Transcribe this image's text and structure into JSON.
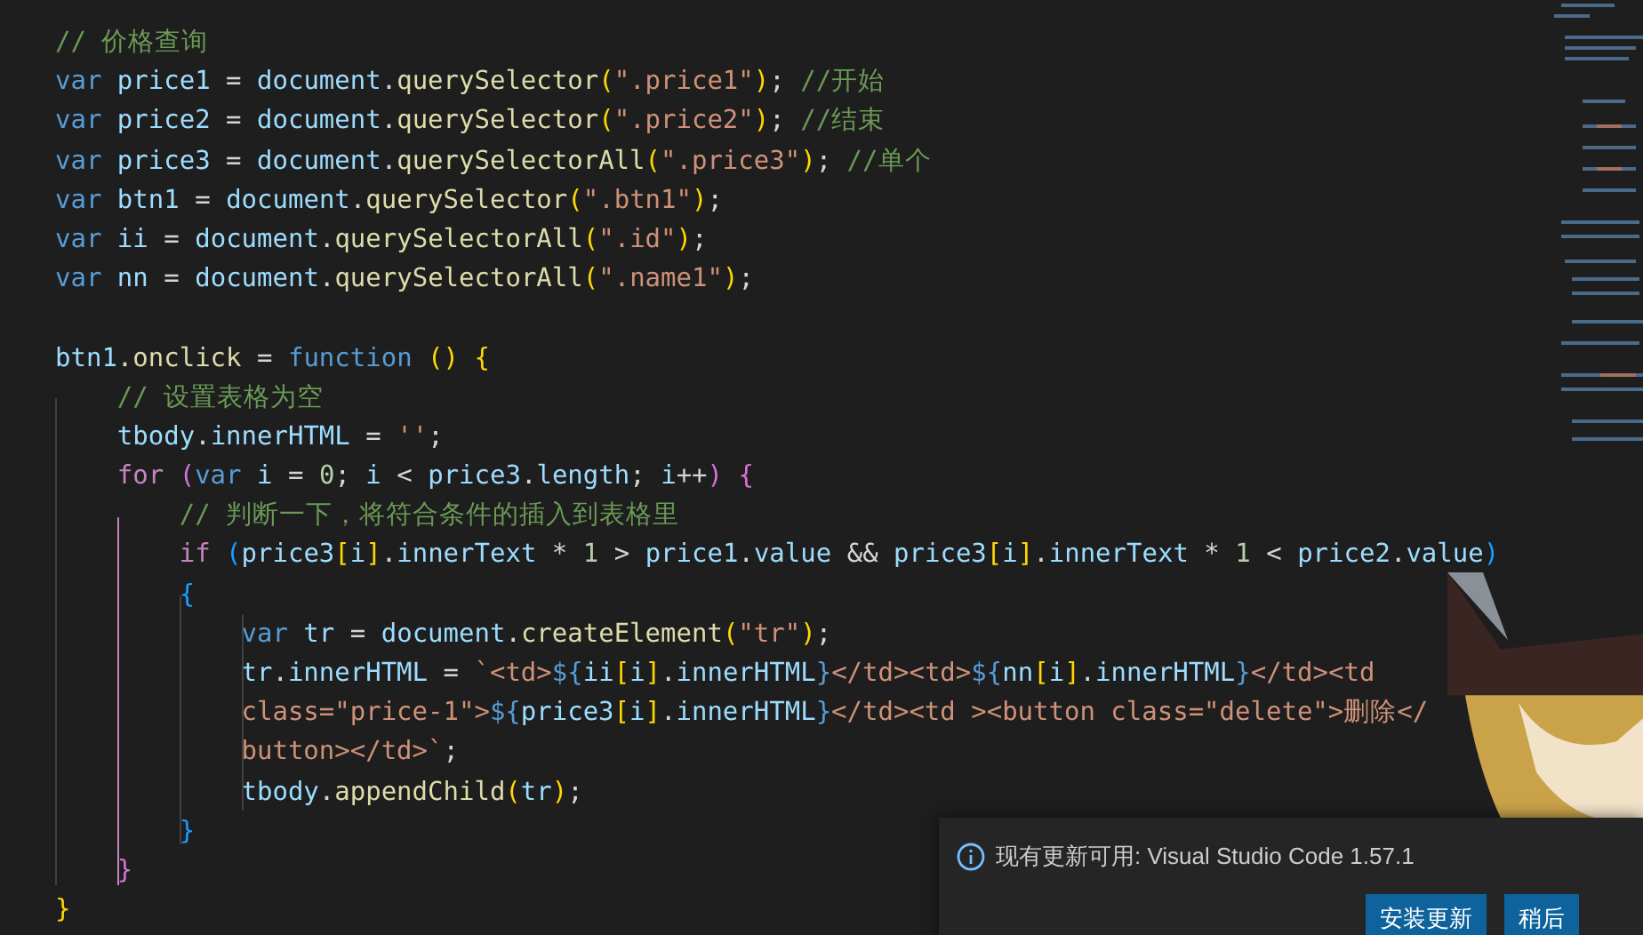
{
  "editor": {
    "code_lines": [
      {
        "kind": "code",
        "tokens": [
          {
            "kind": "cmt",
            "text": "// 价格查询"
          }
        ]
      },
      {
        "kind": "code",
        "tokens": [
          {
            "kind": "kw",
            "text": "var"
          },
          {
            "kind": "var",
            "text": " price1"
          },
          {
            "kind": "op",
            "text": " = "
          },
          {
            "kind": "var",
            "text": "document"
          },
          {
            "kind": "op",
            "text": "."
          },
          {
            "kind": "fn",
            "text": "querySelector"
          },
          {
            "kind": "b1",
            "text": "("
          },
          {
            "kind": "str",
            "text": "\".price1\""
          },
          {
            "kind": "b1",
            "text": ")"
          },
          {
            "kind": "op",
            "text": ";"
          },
          {
            "kind": "cmt",
            "text": " //开始"
          }
        ]
      },
      {
        "kind": "code",
        "tokens": [
          {
            "kind": "kw",
            "text": "var"
          },
          {
            "kind": "var",
            "text": " price2"
          },
          {
            "kind": "op",
            "text": " = "
          },
          {
            "kind": "var",
            "text": "document"
          },
          {
            "kind": "op",
            "text": "."
          },
          {
            "kind": "fn",
            "text": "querySelector"
          },
          {
            "kind": "b1",
            "text": "("
          },
          {
            "kind": "str",
            "text": "\".price2\""
          },
          {
            "kind": "b1",
            "text": ")"
          },
          {
            "kind": "op",
            "text": ";"
          },
          {
            "kind": "cmt",
            "text": " //结束"
          }
        ]
      },
      {
        "kind": "code",
        "tokens": [
          {
            "kind": "kw",
            "text": "var"
          },
          {
            "kind": "var",
            "text": " price3"
          },
          {
            "kind": "op",
            "text": " = "
          },
          {
            "kind": "var",
            "text": "document"
          },
          {
            "kind": "op",
            "text": "."
          },
          {
            "kind": "fn",
            "text": "querySelectorAll"
          },
          {
            "kind": "b1",
            "text": "("
          },
          {
            "kind": "str",
            "text": "\".price3\""
          },
          {
            "kind": "b1",
            "text": ")"
          },
          {
            "kind": "op",
            "text": ";"
          },
          {
            "kind": "cmt",
            "text": " //单个"
          }
        ]
      },
      {
        "kind": "code",
        "tokens": [
          {
            "kind": "kw",
            "text": "var"
          },
          {
            "kind": "var",
            "text": " btn1"
          },
          {
            "kind": "op",
            "text": " = "
          },
          {
            "kind": "var",
            "text": "document"
          },
          {
            "kind": "op",
            "text": "."
          },
          {
            "kind": "fn",
            "text": "querySelector"
          },
          {
            "kind": "b1",
            "text": "("
          },
          {
            "kind": "str",
            "text": "\".btn1\""
          },
          {
            "kind": "b1",
            "text": ")"
          },
          {
            "kind": "op",
            "text": ";"
          }
        ]
      },
      {
        "kind": "code",
        "tokens": [
          {
            "kind": "kw",
            "text": "var"
          },
          {
            "kind": "var",
            "text": " ii"
          },
          {
            "kind": "op",
            "text": " = "
          },
          {
            "kind": "var",
            "text": "document"
          },
          {
            "kind": "op",
            "text": "."
          },
          {
            "kind": "fn",
            "text": "querySelectorAll"
          },
          {
            "kind": "b1",
            "text": "("
          },
          {
            "kind": "str",
            "text": "\".id\""
          },
          {
            "kind": "b1",
            "text": ")"
          },
          {
            "kind": "op",
            "text": ";"
          }
        ]
      },
      {
        "kind": "code",
        "tokens": [
          {
            "kind": "kw",
            "text": "var"
          },
          {
            "kind": "var",
            "text": " nn"
          },
          {
            "kind": "op",
            "text": " = "
          },
          {
            "kind": "var",
            "text": "document"
          },
          {
            "kind": "op",
            "text": "."
          },
          {
            "kind": "fn",
            "text": "querySelectorAll"
          },
          {
            "kind": "b1",
            "text": "("
          },
          {
            "kind": "str",
            "text": "\".name1\""
          },
          {
            "kind": "b1",
            "text": ")"
          },
          {
            "kind": "op",
            "text": ";"
          }
        ]
      },
      {
        "kind": "blank"
      },
      {
        "kind": "code",
        "tokens": [
          {
            "kind": "var",
            "text": "btn1"
          },
          {
            "kind": "op",
            "text": "."
          },
          {
            "kind": "fn",
            "text": "onclick"
          },
          {
            "kind": "op",
            "text": " = "
          },
          {
            "kind": "kw",
            "text": "function"
          },
          {
            "kind": "b1",
            "text": " ()"
          },
          {
            "kind": "b1",
            "text": " {"
          }
        ]
      },
      {
        "kind": "code",
        "tokens": [
          {
            "kind": "cmt",
            "text": "    // 设置表格为空"
          }
        ]
      },
      {
        "kind": "code",
        "tokens": [
          {
            "kind": "var",
            "text": "    tbody"
          },
          {
            "kind": "op",
            "text": "."
          },
          {
            "kind": "var",
            "text": "innerHTML"
          },
          {
            "kind": "op",
            "text": " = "
          },
          {
            "kind": "str",
            "text": "''"
          },
          {
            "kind": "op",
            "text": ";"
          }
        ]
      },
      {
        "kind": "code",
        "tokens": [
          {
            "kind": "ctrl",
            "text": "    for"
          },
          {
            "kind": "b2",
            "text": " ("
          },
          {
            "kind": "kw",
            "text": "var"
          },
          {
            "kind": "var",
            "text": " i"
          },
          {
            "kind": "op",
            "text": " = "
          },
          {
            "kind": "num",
            "text": "0"
          },
          {
            "kind": "op",
            "text": ";"
          },
          {
            "kind": "var",
            "text": " i"
          },
          {
            "kind": "op",
            "text": " < "
          },
          {
            "kind": "var",
            "text": "price3"
          },
          {
            "kind": "op",
            "text": "."
          },
          {
            "kind": "var",
            "text": "length"
          },
          {
            "kind": "op",
            "text": ";"
          },
          {
            "kind": "var",
            "text": " i"
          },
          {
            "kind": "op",
            "text": "++"
          },
          {
            "kind": "b2",
            "text": ")"
          },
          {
            "kind": "b2",
            "text": " {"
          }
        ]
      },
      {
        "kind": "code",
        "tokens": [
          {
            "kind": "cmt",
            "text": "        // 判断一下，将符合条件的插入到表格里"
          }
        ]
      },
      {
        "kind": "code",
        "tokens": [
          {
            "kind": "ctrl",
            "text": "        if"
          },
          {
            "kind": "b3",
            "text": " ("
          },
          {
            "kind": "var",
            "text": "price3"
          },
          {
            "kind": "b1",
            "text": "["
          },
          {
            "kind": "var",
            "text": "i"
          },
          {
            "kind": "b1",
            "text": "]"
          },
          {
            "kind": "op",
            "text": "."
          },
          {
            "kind": "var",
            "text": "innerText"
          },
          {
            "kind": "op",
            "text": " * "
          },
          {
            "kind": "num",
            "text": "1"
          },
          {
            "kind": "op",
            "text": " > "
          },
          {
            "kind": "var",
            "text": "price1"
          },
          {
            "kind": "op",
            "text": "."
          },
          {
            "kind": "var",
            "text": "value"
          },
          {
            "kind": "op",
            "text": " && "
          },
          {
            "kind": "var",
            "text": "price3"
          },
          {
            "kind": "b1",
            "text": "["
          },
          {
            "kind": "var",
            "text": "i"
          },
          {
            "kind": "b1",
            "text": "]"
          },
          {
            "kind": "op",
            "text": "."
          },
          {
            "kind": "var",
            "text": "innerText"
          },
          {
            "kind": "op",
            "text": " * "
          },
          {
            "kind": "num",
            "text": "1"
          },
          {
            "kind": "op",
            "text": " < "
          },
          {
            "kind": "var",
            "text": "price2"
          },
          {
            "kind": "op",
            "text": "."
          },
          {
            "kind": "var",
            "text": "value"
          },
          {
            "kind": "b3",
            "text": ")"
          }
        ]
      },
      {
        "kind": "code",
        "tokens": [
          {
            "kind": "b3",
            "text": "        {"
          }
        ]
      },
      {
        "kind": "code",
        "tokens": [
          {
            "kind": "kw",
            "text": "            var"
          },
          {
            "kind": "var",
            "text": " tr"
          },
          {
            "kind": "op",
            "text": " = "
          },
          {
            "kind": "var",
            "text": "document"
          },
          {
            "kind": "op",
            "text": "."
          },
          {
            "kind": "fn",
            "text": "createElement"
          },
          {
            "kind": "b1",
            "text": "("
          },
          {
            "kind": "str",
            "text": "\"tr\""
          },
          {
            "kind": "b1",
            "text": ")"
          },
          {
            "kind": "op",
            "text": ";"
          }
        ]
      },
      {
        "kind": "code",
        "tokens": [
          {
            "kind": "var",
            "text": "            tr"
          },
          {
            "kind": "op",
            "text": "."
          },
          {
            "kind": "var",
            "text": "innerHTML"
          },
          {
            "kind": "op",
            "text": " = "
          },
          {
            "kind": "str",
            "text": "`<td>"
          },
          {
            "kind": "tpl",
            "text": "${"
          },
          {
            "kind": "var",
            "text": "ii"
          },
          {
            "kind": "b1",
            "text": "["
          },
          {
            "kind": "var",
            "text": "i"
          },
          {
            "kind": "b1",
            "text": "]"
          },
          {
            "kind": "op",
            "text": "."
          },
          {
            "kind": "var",
            "text": "innerHTML"
          },
          {
            "kind": "tpl",
            "text": "}"
          },
          {
            "kind": "str",
            "text": "</td><td>"
          },
          {
            "kind": "tpl",
            "text": "${"
          },
          {
            "kind": "var",
            "text": "nn"
          },
          {
            "kind": "b1",
            "text": "["
          },
          {
            "kind": "var",
            "text": "i"
          },
          {
            "kind": "b1",
            "text": "]"
          },
          {
            "kind": "op",
            "text": "."
          },
          {
            "kind": "var",
            "text": "innerHTML"
          },
          {
            "kind": "tpl",
            "text": "}"
          },
          {
            "kind": "str",
            "text": "</td><td"
          }
        ]
      },
      {
        "kind": "code",
        "tokens": [
          {
            "kind": "str",
            "text": "            class=\"price-1\">"
          },
          {
            "kind": "tpl",
            "text": "${"
          },
          {
            "kind": "var",
            "text": "price3"
          },
          {
            "kind": "b1",
            "text": "["
          },
          {
            "kind": "var",
            "text": "i"
          },
          {
            "kind": "b1",
            "text": "]"
          },
          {
            "kind": "op",
            "text": "."
          },
          {
            "kind": "var",
            "text": "innerHTML"
          },
          {
            "kind": "tpl",
            "text": "}"
          },
          {
            "kind": "str",
            "text": "</td><td ><button class=\"delete\">删除</"
          }
        ]
      },
      {
        "kind": "code",
        "tokens": [
          {
            "kind": "str",
            "text": "            button></td>`"
          },
          {
            "kind": "op",
            "text": ";"
          }
        ]
      },
      {
        "kind": "code",
        "tokens": [
          {
            "kind": "var",
            "text": "            tbody"
          },
          {
            "kind": "op",
            "text": "."
          },
          {
            "kind": "fn",
            "text": "appendChild"
          },
          {
            "kind": "b1",
            "text": "("
          },
          {
            "kind": "var",
            "text": "tr"
          },
          {
            "kind": "b1",
            "text": ")"
          },
          {
            "kind": "op",
            "text": ";"
          }
        ]
      },
      {
        "kind": "code",
        "tokens": [
          {
            "kind": "b3",
            "text": "        }"
          }
        ]
      },
      {
        "kind": "code",
        "tokens": [
          {
            "kind": "b2",
            "text": "    }"
          }
        ]
      },
      {
        "kind": "code",
        "tokens": [
          {
            "kind": "b1",
            "text": "}"
          }
        ]
      }
    ]
  },
  "notification": {
    "message": "现有更新可用: Visual Studio Code 1.57.1",
    "buttons": [
      "安装更新",
      "稍后"
    ]
  }
}
